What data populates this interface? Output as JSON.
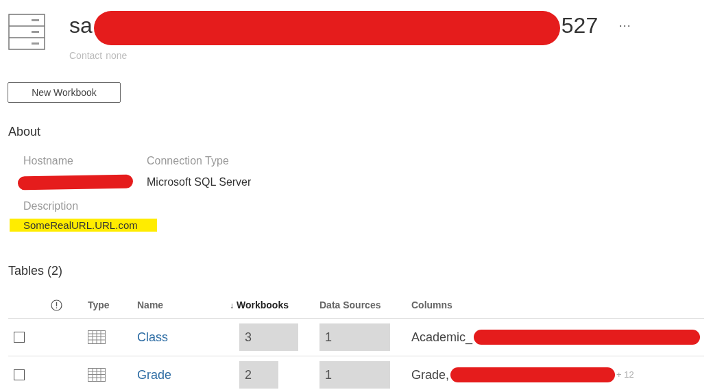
{
  "header": {
    "title_start": "sa",
    "title_end": "527",
    "title_redacted": true,
    "more": "···",
    "contact_label": "Contact",
    "contact_value": "none"
  },
  "new_workbook_button": "New Workbook",
  "about": {
    "heading": "About",
    "fields": [
      {
        "label": "Hostname",
        "redacted": true
      },
      {
        "label": "Connection Type",
        "value": "Microsoft SQL Server",
        "redacted": false
      }
    ],
    "description_label": "Description",
    "description": "SomeRealURL.URL.com",
    "description_highlighted": true
  },
  "tables": {
    "heading": "Tables (2)",
    "columns": [
      {
        "label": "Type",
        "sorted": false
      },
      {
        "label": "Name",
        "sorted": false
      },
      {
        "label": "Workbooks",
        "sorted": true,
        "sort_arrow": "↓"
      },
      {
        "label": "Data Sources",
        "sorted": false
      },
      {
        "label": "Columns",
        "sorted": false
      }
    ],
    "rows": [
      {
        "checked": false,
        "name": "Class",
        "workbooks": "3",
        "data_sources": "1",
        "columns_text": "Academic_",
        "columns_redacted": true
      },
      {
        "checked": false,
        "name": "Grade",
        "workbooks": "2",
        "data_sources": "1",
        "columns_text": "Grade,",
        "columns_redacted": true,
        "more_count": "+ 12"
      }
    ]
  }
}
